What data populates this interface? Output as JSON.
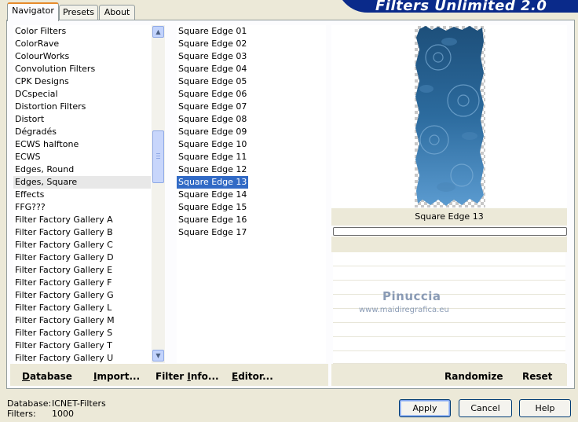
{
  "app": {
    "brand_title": "Filters Unlimited 2.0"
  },
  "tabs": [
    {
      "label": "Navigator",
      "active": true
    },
    {
      "label": "Presets",
      "active": false
    },
    {
      "label": "About",
      "active": false
    }
  ],
  "categories": {
    "items": [
      "Color Filters",
      "ColorRave",
      "ColourWorks",
      "Convolution Filters",
      "CPK Designs",
      "DCspecial",
      "Distortion Filters",
      "Distort",
      "Dégradés",
      "ECWS halftone",
      "ECWS",
      "Edges, Round",
      "Edges, Square",
      "Effects",
      "FFG???",
      "Filter Factory Gallery A",
      "Filter Factory Gallery B",
      "Filter Factory Gallery C",
      "Filter Factory Gallery D",
      "Filter Factory Gallery E",
      "Filter Factory Gallery F",
      "Filter Factory Gallery G",
      "Filter Factory Gallery L",
      "Filter Factory Gallery M",
      "Filter Factory Gallery S",
      "Filter Factory Gallery T",
      "Filter Factory Gallery U"
    ],
    "selected": "Edges, Square",
    "scrollbar": {
      "up_icon": "chevron-up-icon",
      "down_icon": "chevron-down-icon"
    }
  },
  "filters": {
    "items": [
      "Square Edge 01",
      "Square Edge 02",
      "Square Edge 03",
      "Square Edge 04",
      "Square Edge 05",
      "Square Edge 06",
      "Square Edge 07",
      "Square Edge 08",
      "Square Edge 09",
      "Square Edge 10",
      "Square Edge 11",
      "Square Edge 12",
      "Square Edge 13",
      "Square Edge 14",
      "Square Edge 15",
      "Square Edge 16",
      "Square Edge 17"
    ],
    "selected": "Square Edge 13"
  },
  "nav_buttons": {
    "database": "Database",
    "import": "Import...",
    "filter_info": "Filter Info...",
    "editor": "Editor..."
  },
  "preview": {
    "caption": "Square Edge 13",
    "randomize": "Randomize",
    "reset": "Reset",
    "watermark": "Pinuccia",
    "watermark_url": "www.maidiregrafica.eu"
  },
  "status": {
    "database_label": "Database:",
    "database_value": "ICNET-Filters",
    "filters_label": "Filters:",
    "filters_value": "1000"
  },
  "dialog_buttons": {
    "apply": "Apply",
    "cancel": "Cancel",
    "help": "Help"
  },
  "colors": {
    "selection": "#316ac5",
    "brand_banner": "#0a2a8a",
    "tab_accent": "#e68b2c"
  }
}
